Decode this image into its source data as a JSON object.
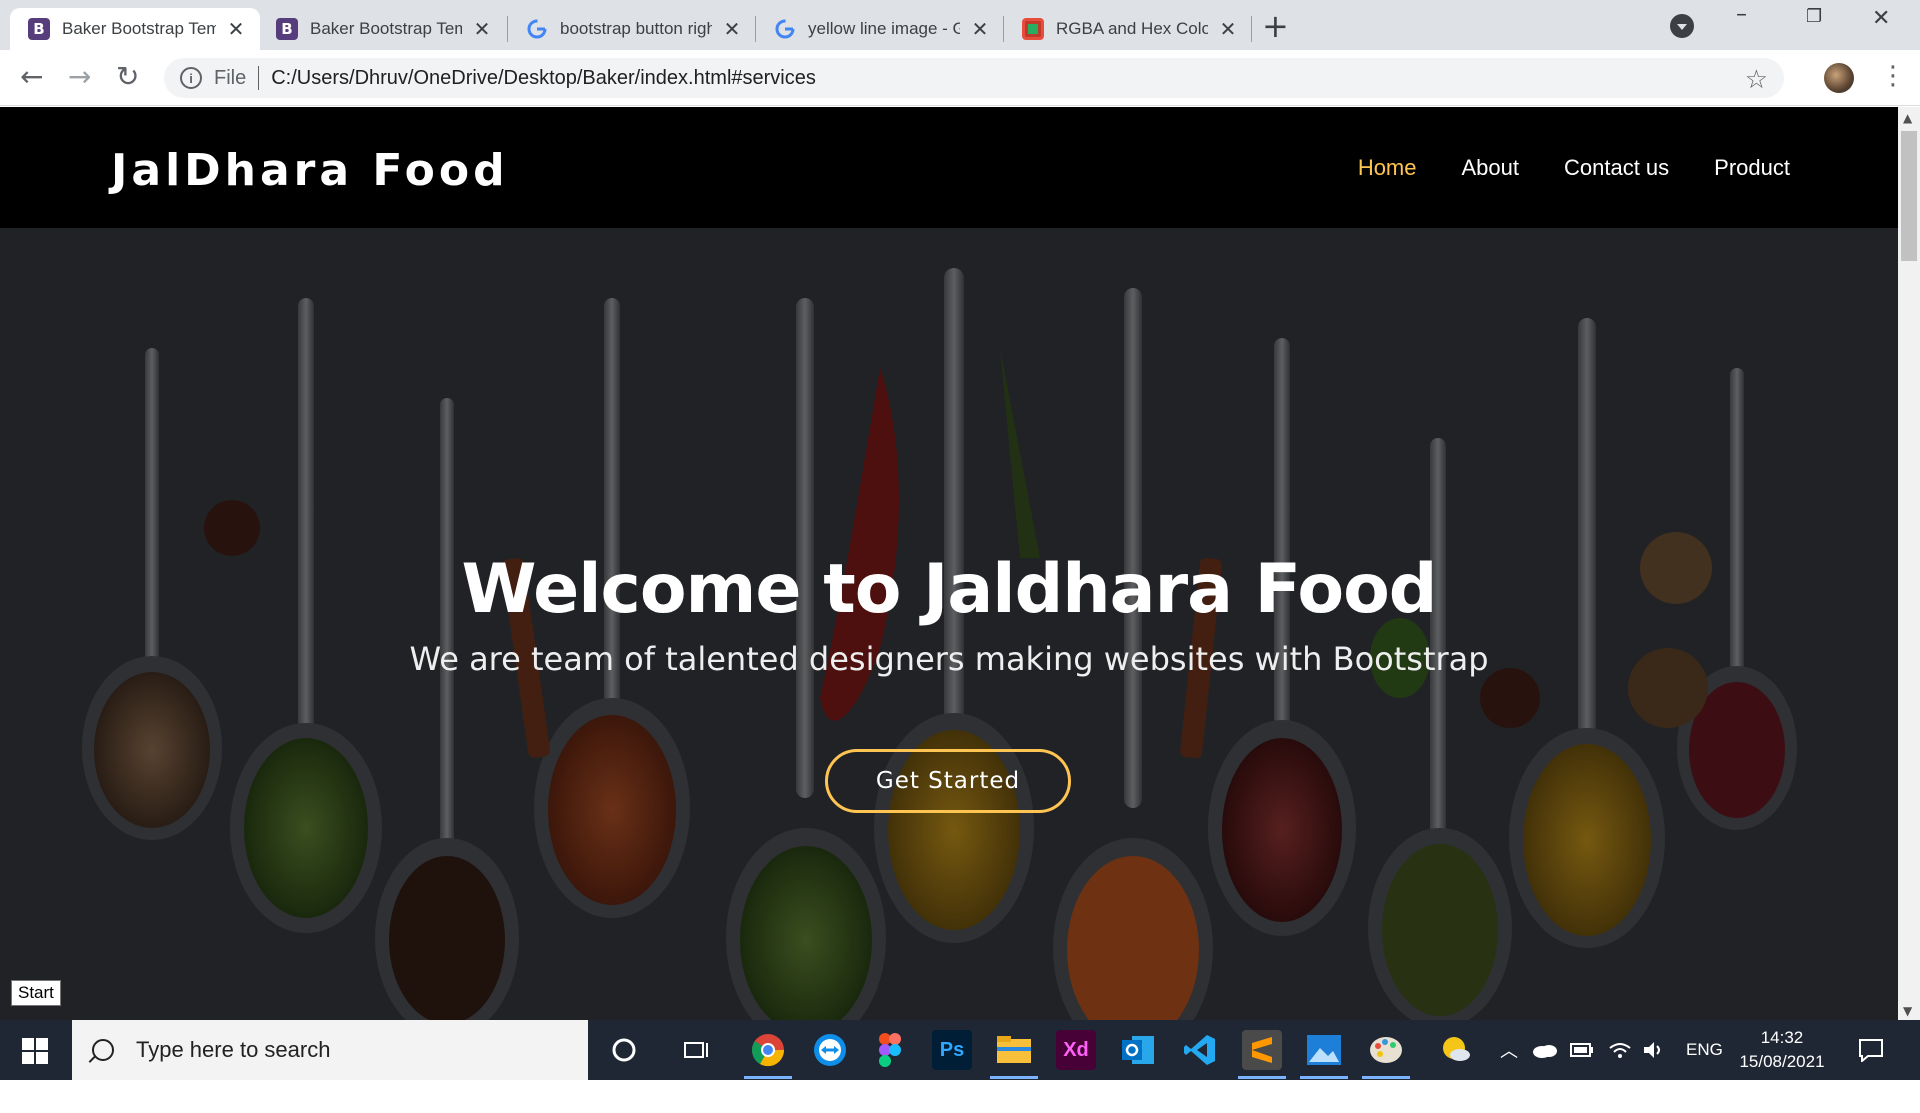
{
  "browser": {
    "tabs": [
      {
        "title": "Baker Bootstrap Template",
        "favicon": "bootstrap-icon",
        "active": true
      },
      {
        "title": "Baker Bootstrap Template",
        "favicon": "bootstrap-icon",
        "active": false
      },
      {
        "title": "bootstrap button right alig",
        "favicon": "google-icon",
        "active": false
      },
      {
        "title": "yellow line image - Google",
        "favicon": "google-icon",
        "active": false
      },
      {
        "title": "RGBA and Hex Color Conv",
        "favicon": "rgba-site-icon",
        "active": false
      }
    ],
    "new_tab": "+",
    "scheme_label": "File",
    "url": "C:/Users/Dhruv/OneDrive/Desktop/Baker/index.html#services"
  },
  "site": {
    "logo": "JalDhara Food",
    "nav": [
      {
        "label": "Home",
        "active": true
      },
      {
        "label": "About",
        "active": false
      },
      {
        "label": "Contact us",
        "active": false
      },
      {
        "label": "Product",
        "active": false
      }
    ],
    "hero": {
      "title": "Welcome to Jaldhara Food",
      "subtitle": "We are team of talented designers making websites with Bootstrap",
      "cta": "Get Started"
    },
    "accent_color": "#ffc451"
  },
  "taskbar": {
    "start_tooltip": "Start",
    "search_placeholder": "Type here to search",
    "apps": [
      "cortana-icon",
      "task-view-icon",
      "chrome-icon",
      "teamviewer-icon",
      "figma-icon",
      "photoshop-icon",
      "file-explorer-icon",
      "adobe-xd-icon",
      "outlook-icon",
      "vscode-icon",
      "sublime-text-icon",
      "photos-icon",
      "paint-icon"
    ],
    "ps_label": "Ps",
    "xd_label": "Xd",
    "language": "ENG",
    "time": "14:32",
    "date": "15/08/2021"
  }
}
